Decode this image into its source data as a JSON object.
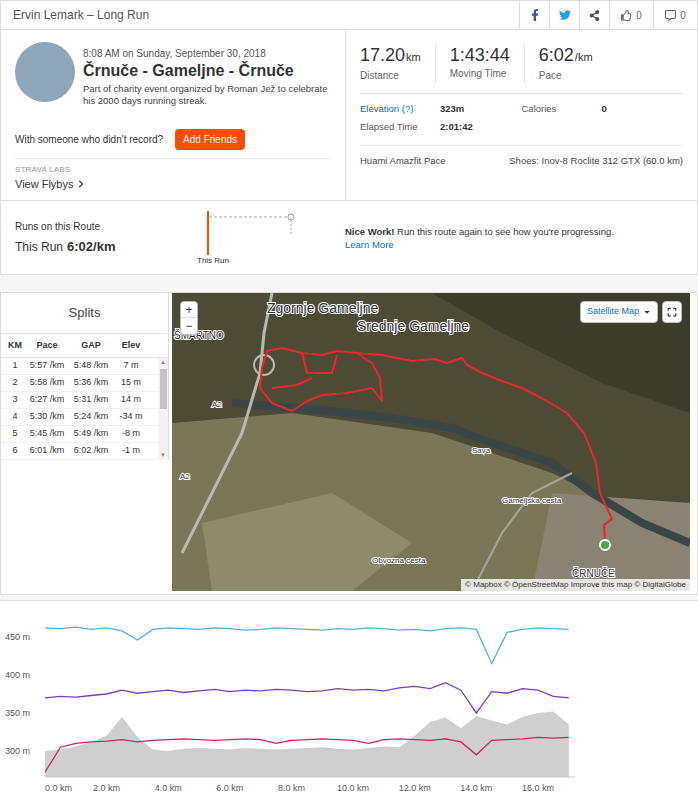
{
  "header": {
    "title": "Ervin Lemark – Long Run",
    "kudos": "0",
    "comments": "0"
  },
  "activity": {
    "date": "8:08 AM on Sunday, September 30, 2018",
    "title": "Črnuče - Gameljne - Črnuče",
    "description": "Part of charity event organized by Roman Jež to celebrate his 2000 days running streak.",
    "friends_prompt": "With someone who didn't record?",
    "add_friends_button": "Add Friends",
    "labs": "STRAVA LABS",
    "flybys_link": "View Flybys"
  },
  "stats": [
    {
      "value": "17.20",
      "unit": "km",
      "label": "Distance"
    },
    {
      "value": "1:43:44",
      "label": "Moving Time"
    },
    {
      "value": "6:02",
      "unit": "/km",
      "label": "Pace"
    }
  ],
  "details": [
    {
      "label": "Elevation (?)",
      "value": "323m",
      "link": true
    },
    {
      "label": "Calories",
      "value": "0",
      "link": false
    },
    {
      "label": "Elapsed Time",
      "value": "2:01:42",
      "link": false
    }
  ],
  "device": "Huami Amazfit Pace",
  "shoes": "Shoes: Inov-8 Roclite 312 GTX (60.0 km)",
  "route": {
    "title": "Runs on this Route",
    "this_run_label": "This Run",
    "this_run_pace": "6:02/km",
    "marker_label": "This Run",
    "message_title": "Nice Work!",
    "message": "Run this route again to see how you're progressing.",
    "learn_more": "Learn More"
  },
  "splits": {
    "title": "Splits",
    "columns": [
      "KM",
      "Pace",
      "GAP",
      "Elev"
    ],
    "rows": [
      [
        "1",
        "5:57 /km",
        "5:48 /km",
        "7 m"
      ],
      [
        "2",
        "5:58 /km",
        "5:36 /km",
        "15 m"
      ],
      [
        "3",
        "6:27 /km",
        "5:31 /km",
        "14 m"
      ],
      [
        "4",
        "5:30 /km",
        "5:24 /km",
        "-34 m"
      ],
      [
        "5",
        "5:45 /km",
        "5:49 /km",
        "-8 m"
      ],
      [
        "6",
        "6:01 /km",
        "6:02 /km",
        "-1 m"
      ]
    ],
    "scroll_up": "▲",
    "scroll_down": "▼"
  },
  "map": {
    "zoom_in": "+",
    "zoom_out": "−",
    "type_button": "Satellite Map",
    "labels": [
      "Zgornje Gameljne",
      "Srednje Gameljne",
      "ŠMARTNO",
      "ČRNUČE",
      "Sava",
      "A2",
      "A2",
      "Gameljska cesta",
      "Obvozna cesta"
    ],
    "attribution": "© Mapbox © OpenStreetMap Improve this map © DigitalGlobe"
  },
  "elevation_chart": {
    "y_ticks": [
      "450 m",
      "400 m",
      "350 m",
      "300 m"
    ],
    "x_ticks": [
      "0.0 km",
      "2.0 km",
      "4.0 km",
      "6.0 km",
      "8.0 km",
      "10.0 km",
      "12.0 km",
      "14.0 km",
      "16.0 km"
    ],
    "series": [
      {
        "kind": "area",
        "color": "#cfcfcf",
        "values": [
          300,
          302,
          306,
          312,
          320,
          345,
          318,
          302,
          300,
          303,
          304,
          303,
          302,
          304,
          303,
          302,
          303,
          304,
          305,
          303,
          302,
          304,
          306,
          305,
          320,
          338,
          344,
          330,
          346,
          340,
          335,
          345,
          350,
          352,
          335
        ]
      },
      {
        "kind": "line",
        "color": "#4fb3d9",
        "values": [
          462,
          461,
          463,
          460,
          462,
          458,
          446,
          460,
          462,
          461,
          460,
          462,
          461,
          459,
          460,
          462,
          461,
          460,
          459,
          461,
          460,
          462,
          461,
          459,
          460,
          458,
          461,
          462,
          460,
          415,
          456,
          460,
          462,
          461,
          460
        ]
      },
      {
        "kind": "line",
        "color": "#7b3fc4",
        "values": [
          370,
          372,
          371,
          373,
          375,
          380,
          376,
          378,
          380,
          377,
          379,
          381,
          378,
          380,
          379,
          381,
          380,
          378,
          379,
          382,
          380,
          381,
          379,
          383,
          385,
          382,
          390,
          380,
          350,
          378,
          376,
          382,
          380,
          372,
          370
        ]
      },
      {
        "kind": "line",
        "color": "#d1245a",
        "values": [
          272,
          305,
          310,
          312,
          313,
          315,
          312,
          314,
          315,
          316,
          315,
          314,
          315,
          316,
          315,
          310,
          314,
          315,
          316,
          315,
          314,
          310,
          315,
          316,
          315,
          314,
          316,
          312,
          295,
          314,
          315,
          316,
          318,
          317,
          318
        ]
      }
    ]
  }
}
